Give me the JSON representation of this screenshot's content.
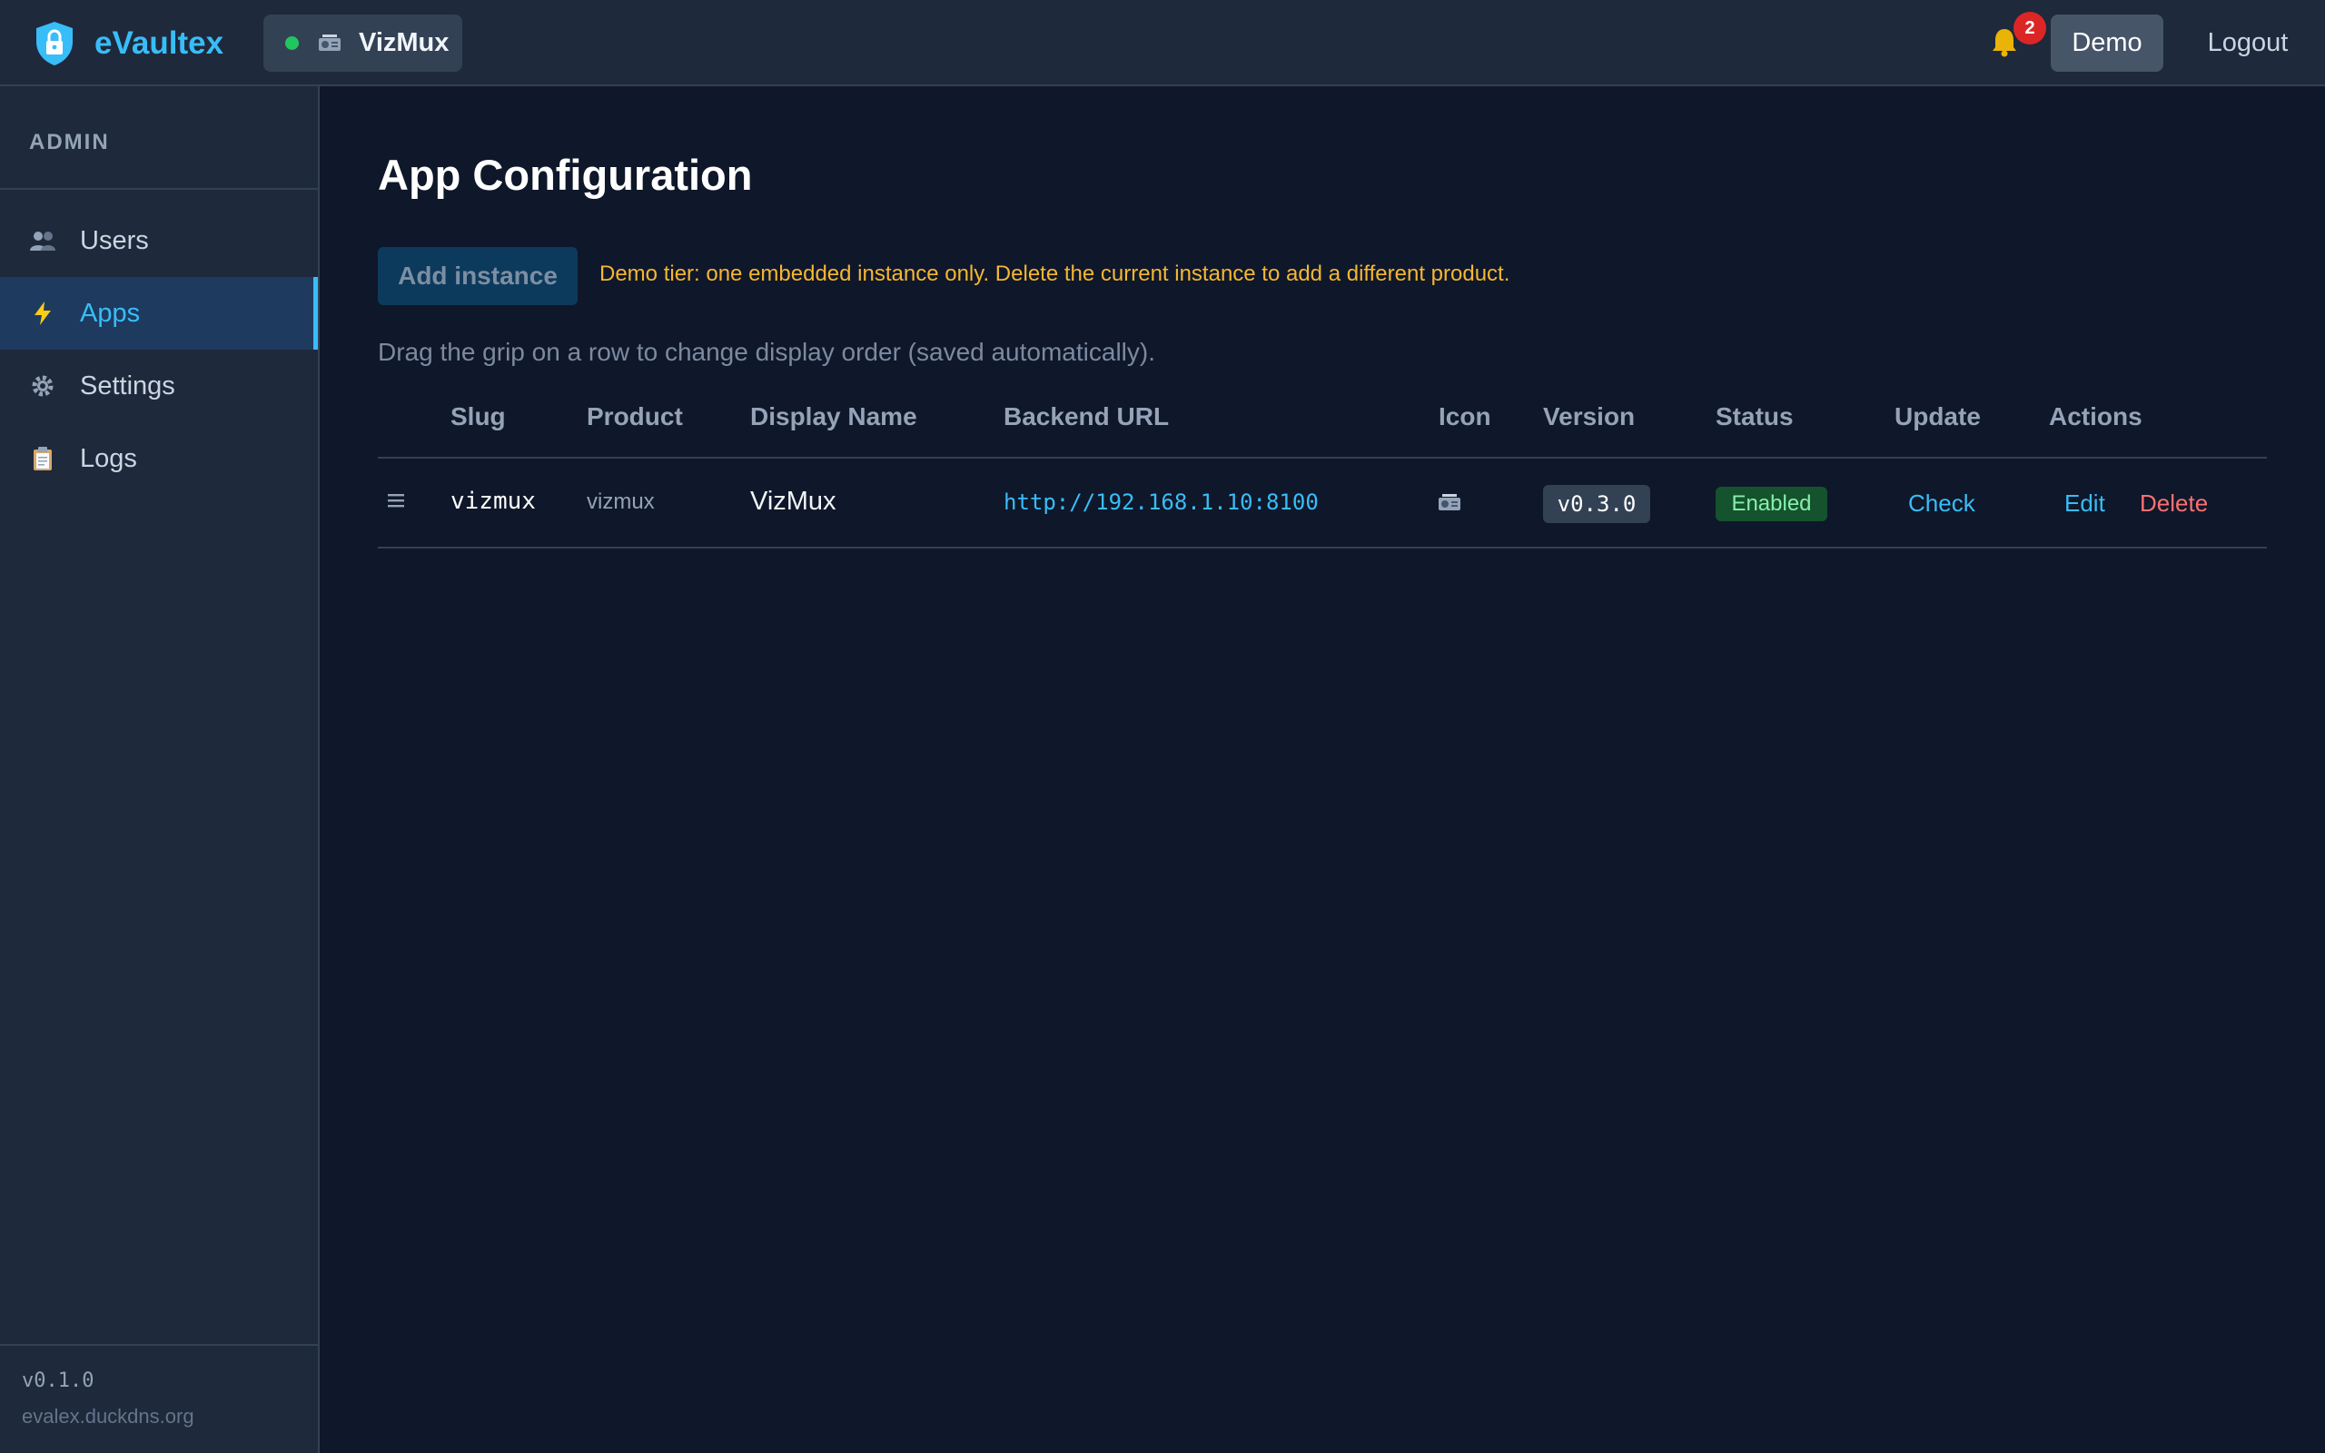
{
  "header": {
    "brand": "eVaultex",
    "app_switcher": {
      "name": "VizMux",
      "status_color": "#22c55e",
      "icon": "projector-icon"
    },
    "notifications": {
      "count": "2",
      "icon": "bell-icon"
    },
    "user_button": "Demo",
    "logout": "Logout"
  },
  "sidebar": {
    "heading": "ADMIN",
    "items": [
      {
        "label": "Users",
        "icon": "users-icon"
      },
      {
        "label": "Apps",
        "icon": "lightning-icon",
        "active": true
      },
      {
        "label": "Settings",
        "icon": "gear-icon"
      },
      {
        "label": "Logs",
        "icon": "clipboard-icon"
      }
    ],
    "version": "v0.1.0",
    "host": "evalex.duckdns.org"
  },
  "main": {
    "title": "App Configuration",
    "add_button": "Add instance",
    "demo_note": "Demo tier: one embedded instance only. Delete the current instance to add a different product.",
    "drag_hint": "Drag the grip on a row to change display order (saved automatically).",
    "table": {
      "columns": [
        "Slug",
        "Product",
        "Display Name",
        "Backend URL",
        "Icon",
        "Version",
        "Status",
        "Update",
        "Actions"
      ],
      "rows": [
        {
          "slug": "vizmux",
          "product": "vizmux",
          "display_name": "VizMux",
          "backend_url": "http://192.168.1.10:8100",
          "icon": "projector-icon",
          "version": "v0.3.0",
          "status": "Enabled",
          "update": "Check",
          "actions": {
            "edit": "Edit",
            "delete": "Delete"
          }
        }
      ]
    }
  },
  "colors": {
    "accent": "#38bdf8",
    "background": "#0f172a",
    "panel": "#1e293b",
    "warning": "#f5b731",
    "danger": "#f87171",
    "success": "#86efac"
  }
}
